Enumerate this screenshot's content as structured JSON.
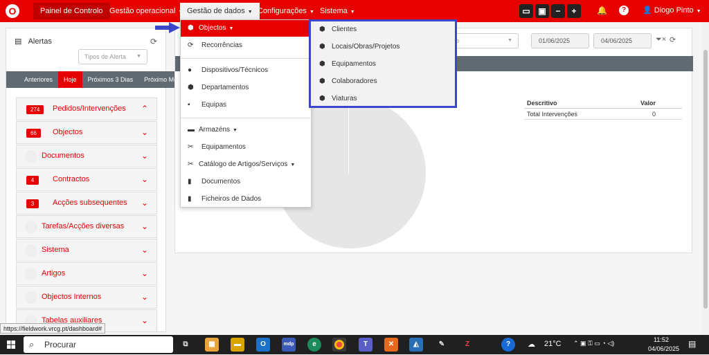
{
  "nav": {
    "logo": "O",
    "items": [
      {
        "label": "Painel de Controlo"
      },
      {
        "label": "Gestão operacional"
      },
      {
        "label": "Gestão de dados"
      },
      {
        "label": "Configurações"
      },
      {
        "label": "Sistema"
      }
    ],
    "user": "Diogo Pinto"
  },
  "alerts": {
    "title": "Alertas",
    "type_placeholder": "Tipos de Alerta",
    "tabs": [
      "Anteriores",
      "Hoje",
      "Próximos 3 Dias",
      "Próximo Mês"
    ],
    "items": [
      {
        "count": "274",
        "label": "Pedidos/Intervenções",
        "chev": "⌃"
      },
      {
        "count": "66",
        "label": "Objectos",
        "chev": "⌄"
      },
      {
        "count": "",
        "label": "Documentos",
        "chev": "⌄"
      },
      {
        "count": "4",
        "label": "Contractos",
        "chev": "⌄"
      },
      {
        "count": "3",
        "label": "Acções subsequentes",
        "chev": "⌄"
      },
      {
        "count": "",
        "label": "Tarefas/Acções diversas",
        "chev": "⌄"
      },
      {
        "count": "",
        "label": "Sistema",
        "chev": "⌄"
      },
      {
        "count": "",
        "label": "Artigos",
        "chev": "⌄"
      },
      {
        "count": "",
        "label": "Objectos Internos",
        "chev": "⌄"
      },
      {
        "count": "",
        "label": "Tabelas auxiliares",
        "chev": "⌄"
      }
    ]
  },
  "main": {
    "select_text": "lo",
    "date_from": "01/06/2025",
    "date_to": "04/06/2025",
    "table": {
      "headers": [
        "Descritivo",
        "Valor"
      ],
      "rows": [
        [
          "Total Intervenções",
          "0"
        ]
      ]
    }
  },
  "dropdown": {
    "items": [
      {
        "label": "Objectos",
        "icon": "cubes-icon"
      },
      {
        "label": "Recorrências",
        "icon": "refresh-icon"
      },
      {
        "label": "Dispositivos/Técnicos",
        "icon": "user-icon"
      },
      {
        "label": "Departamentos",
        "icon": "cubes-icon"
      },
      {
        "label": "Equipas",
        "icon": "briefcase-icon"
      },
      {
        "label": "Armazéns",
        "icon": "warehouse-icon"
      },
      {
        "label": "Equipamentos",
        "icon": "tools-icon"
      },
      {
        "label": "Catálogo de Artigos/Serviços",
        "icon": "tools-icon"
      },
      {
        "label": "Documentos",
        "icon": "file-icon"
      },
      {
        "label": "Ficheiros de Dados",
        "icon": "file-icon"
      }
    ]
  },
  "submenu": {
    "items": [
      "Clientes",
      "Locais/Obras/Projetos",
      "Equipamentos",
      "Colaboradores",
      "Viaturas"
    ]
  },
  "status_url": "https://fieldwork.vrcg.pt/dashboard#",
  "taskbar": {
    "search_placeholder": "Procurar",
    "weather": "21°C",
    "time": "11:52",
    "date": "04/06/2025"
  },
  "colors": {
    "brand": "#e60000",
    "highlight_border": "#3b46c9"
  }
}
